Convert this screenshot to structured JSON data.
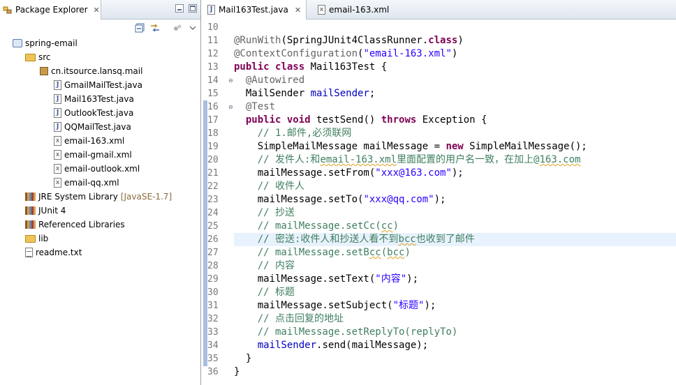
{
  "explorer": {
    "tab_title": "Package Explorer",
    "tree": [
      {
        "label": "spring-email",
        "icon": "project-icon",
        "indent": 0
      },
      {
        "label": "src",
        "icon": "source-folder-icon",
        "indent": 1
      },
      {
        "label": "cn.itsource.lansq.mail",
        "icon": "package-icon",
        "indent": 2
      },
      {
        "label": "GmailMailTest.java",
        "icon": "java-file-icon",
        "indent": 3
      },
      {
        "label": "Mail163Test.java",
        "icon": "java-file-icon",
        "indent": 3
      },
      {
        "label": "OutlookTest.java",
        "icon": "java-file-icon",
        "indent": 3
      },
      {
        "label": "QQMailTest.java",
        "icon": "java-file-icon",
        "indent": 3
      },
      {
        "label": "email-163.xml",
        "icon": "xml-file-icon",
        "indent": 3
      },
      {
        "label": "email-gmail.xml",
        "icon": "xml-file-icon",
        "indent": 3
      },
      {
        "label": "email-outlook.xml",
        "icon": "xml-file-icon",
        "indent": 3
      },
      {
        "label": "email-qq.xml",
        "icon": "xml-file-icon",
        "indent": 3
      },
      {
        "label": "JRE System Library",
        "suffix": "[JavaSE-1.7]",
        "icon": "library-icon",
        "indent": 1
      },
      {
        "label": "JUnit 4",
        "icon": "library-icon",
        "indent": 1
      },
      {
        "label": "Referenced Libraries",
        "icon": "library-icon",
        "indent": 1
      },
      {
        "label": "lib",
        "icon": "folder-icon",
        "indent": 1
      },
      {
        "label": "readme.txt",
        "icon": "text-file-icon",
        "indent": 1
      }
    ]
  },
  "editor": {
    "tabs": [
      {
        "label": "Mail163Test.java",
        "icon": "java-file-icon",
        "active": true
      },
      {
        "label": "email-163.xml",
        "icon": "xml-file-icon",
        "active": false
      }
    ],
    "lines": [
      {
        "n": "10",
        "t": ""
      },
      {
        "n": "11",
        "t": "@RunWith(SpringJUnit4ClassRunner.class)"
      },
      {
        "n": "12",
        "t": "@ContextConfiguration(\"email-163.xml\")"
      },
      {
        "n": "13",
        "t": "public class Mail163Test {"
      },
      {
        "n": "14",
        "t": "  @Autowired",
        "fold": true
      },
      {
        "n": "15",
        "t": "  MailSender mailSender;"
      },
      {
        "n": "16",
        "t": "  @Test",
        "fold": true
      },
      {
        "n": "17",
        "t": "  public void testSend() throws Exception {"
      },
      {
        "n": "18",
        "t": "    // 1.邮件,必须联网"
      },
      {
        "n": "19",
        "t": "    SimpleMailMessage mailMessage = new SimpleMailMessage();"
      },
      {
        "n": "20",
        "t": "    // 发件人:和email-163.xml里面配置的用户名一致，在加上@163.com"
      },
      {
        "n": "21",
        "t": "    mailMessage.setFrom(\"xxx@163.com\");"
      },
      {
        "n": "22",
        "t": "    // 收件人"
      },
      {
        "n": "23",
        "t": "    mailMessage.setTo(\"xxx@qq.com\");"
      },
      {
        "n": "24",
        "t": "    // 抄送"
      },
      {
        "n": "25",
        "t": "    // mailMessage.setCc(cc)"
      },
      {
        "n": "26",
        "t": "    // 密送:收件人和抄送人看不到bcc也收到了邮件",
        "highlight": true
      },
      {
        "n": "27",
        "t": "    // mailMessage.setBcc(bcc)"
      },
      {
        "n": "28",
        "t": "    // 内容"
      },
      {
        "n": "29",
        "t": "    mailMessage.setText(\"内容\");"
      },
      {
        "n": "30",
        "t": "    // 标题"
      },
      {
        "n": "31",
        "t": "    mailMessage.setSubject(\"标题\");"
      },
      {
        "n": "32",
        "t": "    // 点击回复的地址"
      },
      {
        "n": "33",
        "t": "    // mailMessage.setReplyTo(replyTo)"
      },
      {
        "n": "34",
        "t": "    mailSender.send(mailMessage);"
      },
      {
        "n": "35",
        "t": "  }"
      },
      {
        "n": "36",
        "t": "}"
      }
    ]
  },
  "colors": {
    "keyword": "#7f0055",
    "annotation": "#646464",
    "string": "#2a00ff",
    "comment": "#3f7f5f",
    "field": "#0000c0",
    "current_line": "#e8f2fe"
  }
}
